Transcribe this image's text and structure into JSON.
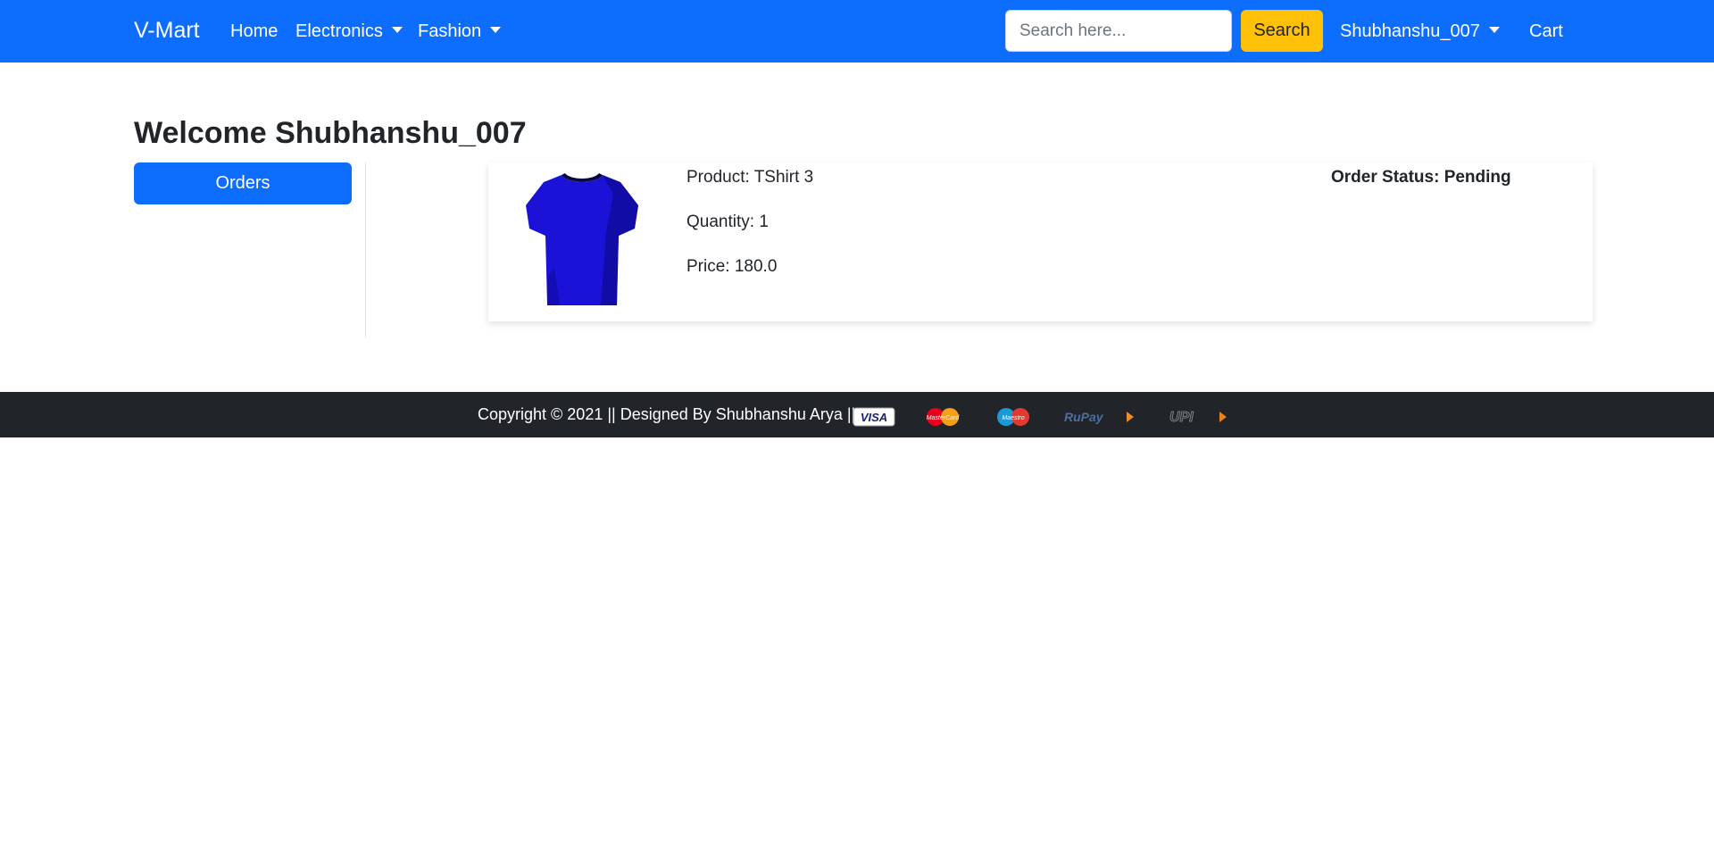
{
  "navbar": {
    "brand": "V-Mart",
    "links": {
      "home": "Home",
      "electronics": "Electronics",
      "fashion": "Fashion"
    },
    "search": {
      "placeholder": "Search here...",
      "value": "",
      "button_label": "Search"
    },
    "user_menu": "Shubhanshu_007",
    "cart": "Cart"
  },
  "main": {
    "welcome": "Welcome Shubhanshu_007",
    "sidebar_button": "Orders",
    "order": {
      "product": "Product: TShirt 3",
      "quantity": "Quantity: 1",
      "price": "Price: 180.0",
      "status": "Order Status: Pending",
      "image_color": "#1a12d6"
    }
  },
  "footer": {
    "copyright": "Copyright © 2021 || Designed By Shubhanshu Arya ||",
    "payment_logos": {
      "visa": "VISA",
      "mastercard": "MasterCard",
      "maestro": "Maestro",
      "rupay": "RuPay",
      "upi": "UPI"
    }
  },
  "colors": {
    "navbar": "#0d6efd",
    "search_button": "#ffc107",
    "footer": "#212529"
  }
}
